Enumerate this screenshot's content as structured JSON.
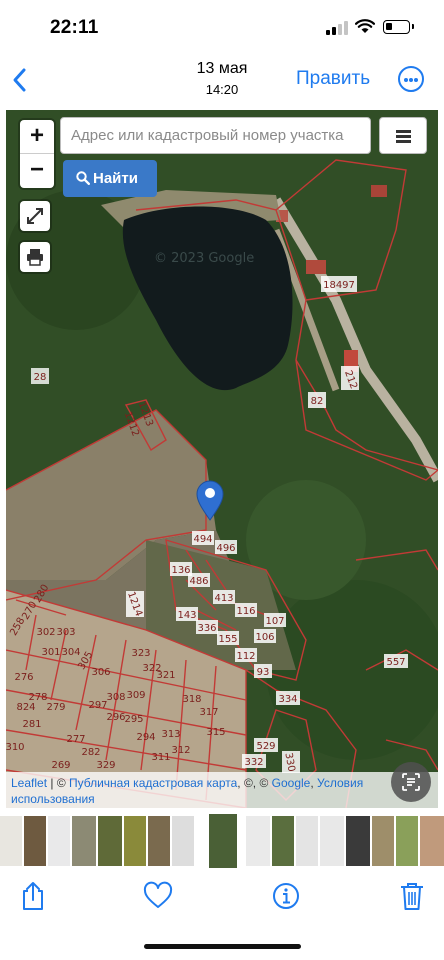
{
  "status": {
    "time": "22:11"
  },
  "nav": {
    "back_label": "‹",
    "date": "13 мая",
    "time": "14:20",
    "edit_label": "Править"
  },
  "map": {
    "zoom_in": "+",
    "zoom_out": "−",
    "search_placeholder": "Адрес или кадастровый номер участка",
    "find_label": "Найти",
    "watermark": "© 2023 Google",
    "parcels": [
      "18497",
      "212",
      "82",
      "28",
      "1213",
      "1212",
      "494",
      "496",
      "136",
      "486",
      "1214",
      "413",
      "116",
      "107",
      "143",
      "336",
      "106",
      "155",
      "112",
      "557",
      "93",
      "334",
      "529",
      "330",
      "280",
      "270",
      "258",
      "302",
      "303",
      "301",
      "304",
      "305",
      "306",
      "276",
      "278",
      "279",
      "277",
      "323",
      "322",
      "321",
      "297",
      "309",
      "308",
      "296",
      "294",
      "318",
      "317",
      "315",
      "293",
      "312",
      "311",
      "282",
      "281",
      "269",
      "329",
      "313",
      "310",
      "332"
    ],
    "attribution": {
      "leaflet": "Leaflet",
      "sep1": " | © ",
      "pkk": "Публичная кадастровая карта",
      "sep2": ", ©, © ",
      "google": "Google",
      "sep3": ", ",
      "terms": "Условия использования"
    }
  },
  "toolbar": {
    "share_icon": "share-icon",
    "favorite_icon": "heart-icon",
    "info_icon": "info-icon",
    "delete_icon": "trash-icon"
  },
  "colors": {
    "accent": "#1f7bef",
    "parcel_border": "#c23a36",
    "find_button": "#3a79c8"
  }
}
